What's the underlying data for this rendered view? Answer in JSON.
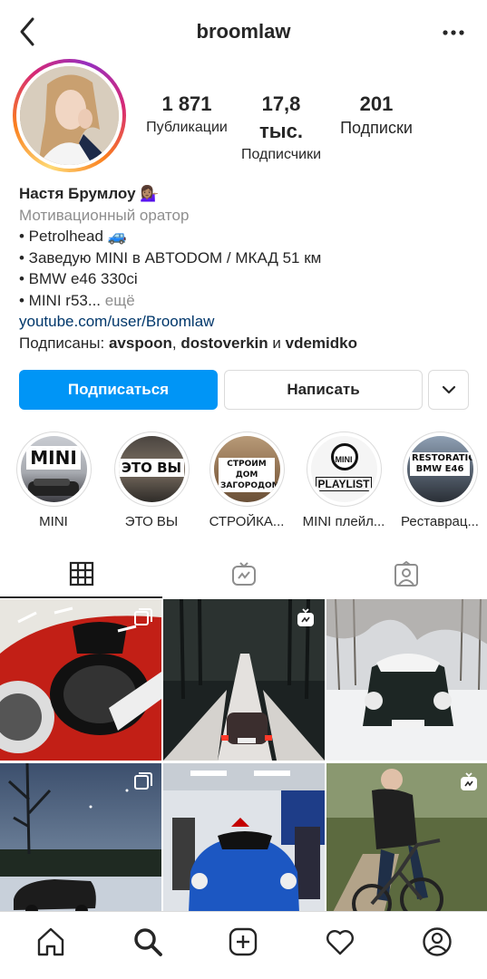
{
  "header": {
    "username": "broomlaw",
    "back_icon": "back-arrow-icon",
    "more_icon": "more-dots-icon"
  },
  "stats": [
    {
      "value": "1 871",
      "label": "Публикации"
    },
    {
      "value": "17,8 тыс.",
      "label": "Подписчики"
    },
    {
      "value": "201",
      "label": "Подписки"
    }
  ],
  "bio": {
    "name": "Настя Брумлоу",
    "name_emoji": "💁🏽‍♀️",
    "category": "Мотивационный оратор",
    "lines": [
      "• Petrolhead 🚙",
      "• Заведую MINI в ABTODOM / МКАД 51 км",
      "• BMW e46 330ci"
    ],
    "truncated_line": "• MINI r53...",
    "more_label": "ещё",
    "link": "youtube.com/user/Broomlaw",
    "followed_prefix": "Подписаны:",
    "followed_user1": "avspoon",
    "followed_user2": "dostoverkin",
    "followed_and": "и",
    "followed_user3": "vdemidko"
  },
  "buttons": {
    "follow": "Подписаться",
    "message": "Написать",
    "dropdown_icon": "chevron-down-icon"
  },
  "highlights": [
    {
      "label": "MINI",
      "cover_text": "MINI"
    },
    {
      "label": "ЭТО ВЫ",
      "cover_text": "ЭТО ВЫ"
    },
    {
      "label": "СТРОЙКА...",
      "cover_text": "СТРОИМ ДОМ ЗАГОРОДОМ"
    },
    {
      "label": "MINI плейл...",
      "cover_text": "PLAYLIST",
      "cover_text2": "MINI"
    },
    {
      "label": "Реставрац...",
      "cover_text": "RESTORATION BMW E46"
    }
  ],
  "tabs": [
    {
      "name": "grid",
      "icon": "grid-icon",
      "active": true
    },
    {
      "name": "igtv",
      "icon": "igtv-icon",
      "active": false
    },
    {
      "name": "tagged",
      "icon": "tagged-person-icon",
      "active": false
    }
  ],
  "posts": [
    {
      "subject": "red-mini-headlight",
      "badge": "carousel-icon"
    },
    {
      "subject": "mini-winter-road",
      "badge": "igtv-icon"
    },
    {
      "subject": "mini-snow-front",
      "badge": ""
    },
    {
      "subject": "mini-night-sky",
      "badge": "carousel-icon"
    },
    {
      "subject": "blue-mini-showroom",
      "badge": ""
    },
    {
      "subject": "bicycle-rider",
      "badge": "igtv-icon"
    }
  ],
  "bottom_nav": [
    "home-icon",
    "search-icon",
    "new-post-icon",
    "activity-heart-icon",
    "profile-icon"
  ],
  "colors": {
    "accent": "#0095f6",
    "link": "#00376b",
    "secondary_text": "#8e8e8e",
    "border": "#dbdbdb"
  }
}
